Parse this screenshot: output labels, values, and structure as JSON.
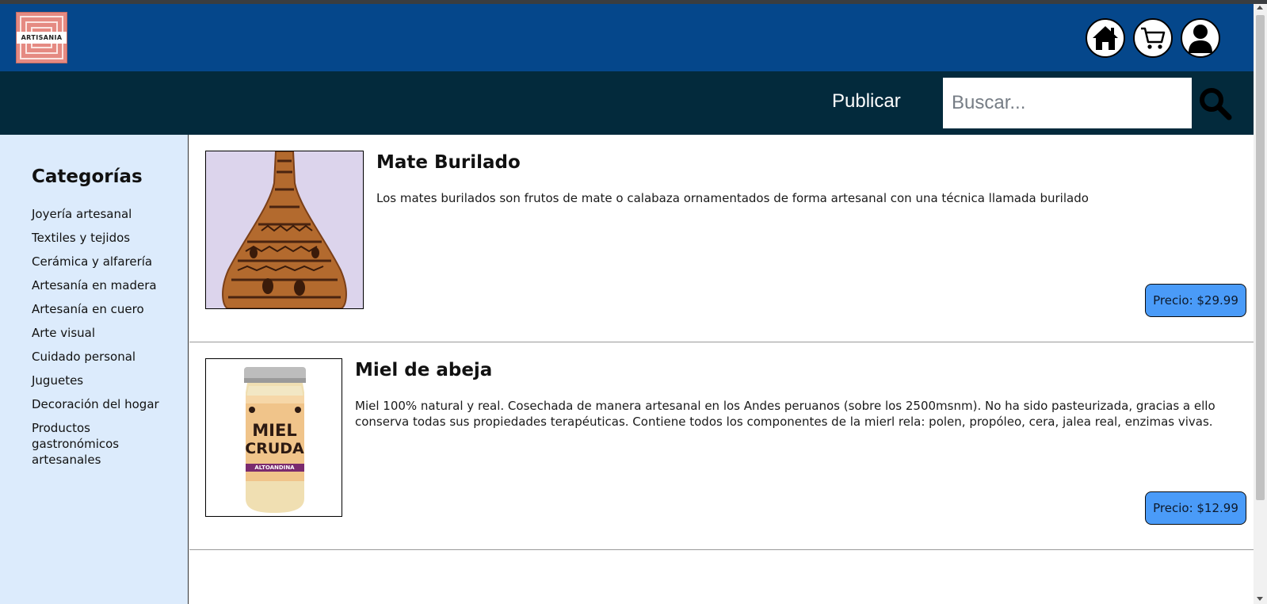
{
  "header": {
    "logo_text": "ARTISANIA",
    "icons": [
      "home-icon",
      "cart-icon",
      "user-icon"
    ],
    "brand_color": "#05478b"
  },
  "nav": {
    "publicar_label": "Publicar",
    "search_placeholder": "Buscar...",
    "search_value": "",
    "bg_color": "#032a3c"
  },
  "sidebar": {
    "title": "Categorías",
    "items": [
      "Joyería artesanal",
      "Textiles y tejidos",
      "Cerámica y alfarería",
      "Artesanía en madera",
      "Artesanía en cuero",
      "Arte visual",
      "Cuidado personal",
      "Juguetes",
      "Decoración del hogar",
      "Productos gastronómicos artesanales"
    ],
    "bg_color": "#dcebfc"
  },
  "products": [
    {
      "title": "Mate Burilado",
      "description": "Los mates burilados son frutos de mate o calabaza ornamentados de forma artesanal con una técnica llamada burilado",
      "price": "Precio: $29.99"
    },
    {
      "title": "Miel de abeja",
      "description": "Miel 100% natural y real. Cosechada de manera artesanal en los Andes peruanos (sobre los 2500msnm). No ha sido pasteurizada, gracias a ello conserva todas sus propiedades terapéuticas. Contiene todos los componentes de la mierl rela: polen, propóleo, cera, jalea real, enzimas vivas.",
      "price": "Precio: $12.99",
      "image_label_line1": "MIEL",
      "image_label_line2": "CRUDA",
      "image_label_line3": "ALTOANDINA"
    }
  ],
  "price_button_color": "#4a9bf8"
}
